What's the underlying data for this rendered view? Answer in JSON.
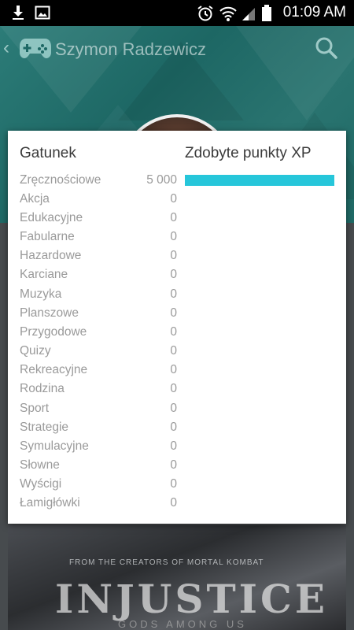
{
  "status_bar": {
    "time": "01:09 AM",
    "icons": [
      "download-icon",
      "image-icon",
      "alarm-icon",
      "wifi-icon",
      "signal-icon",
      "battery-icon"
    ]
  },
  "app_bar": {
    "profile_name": "Szymon Radzewicz",
    "icons": [
      "back-chevron-icon",
      "gamepad-icon",
      "search-icon"
    ]
  },
  "dialog": {
    "col_genre": "Gatunek",
    "col_xp": "Zdobyte punkty XP",
    "bar_color": "#26c6da",
    "rows": [
      {
        "genre": "Zręcznościowe",
        "xp": "5 000",
        "fraction": 1.0
      },
      {
        "genre": "Akcja",
        "xp": "0",
        "fraction": 0
      },
      {
        "genre": "Edukacyjne",
        "xp": "0",
        "fraction": 0
      },
      {
        "genre": "Fabularne",
        "xp": "0",
        "fraction": 0
      },
      {
        "genre": "Hazardowe",
        "xp": "0",
        "fraction": 0
      },
      {
        "genre": "Karciane",
        "xp": "0",
        "fraction": 0
      },
      {
        "genre": "Muzyka",
        "xp": "0",
        "fraction": 0
      },
      {
        "genre": "Planszowe",
        "xp": "0",
        "fraction": 0
      },
      {
        "genre": "Przygodowe",
        "xp": "0",
        "fraction": 0
      },
      {
        "genre": "Quizy",
        "xp": "0",
        "fraction": 0
      },
      {
        "genre": "Rekreacyjne",
        "xp": "0",
        "fraction": 0
      },
      {
        "genre": "Rodzina",
        "xp": "0",
        "fraction": 0
      },
      {
        "genre": "Sport",
        "xp": "0",
        "fraction": 0
      },
      {
        "genre": "Strategie",
        "xp": "0",
        "fraction": 0
      },
      {
        "genre": "Symulacyjne",
        "xp": "0",
        "fraction": 0
      },
      {
        "genre": "Słowne",
        "xp": "0",
        "fraction": 0
      },
      {
        "genre": "Wyścigi",
        "xp": "0",
        "fraction": 0
      },
      {
        "genre": "Łamigłówki",
        "xp": "0",
        "fraction": 0
      }
    ]
  },
  "poster": {
    "subtitle": "FROM THE CREATORS OF MORTAL KOMBAT",
    "title": "INJUSTICE",
    "title_line2": "GODS AMONG US"
  },
  "colors": {
    "accent": "#26c6da",
    "header": "#1d6764"
  }
}
